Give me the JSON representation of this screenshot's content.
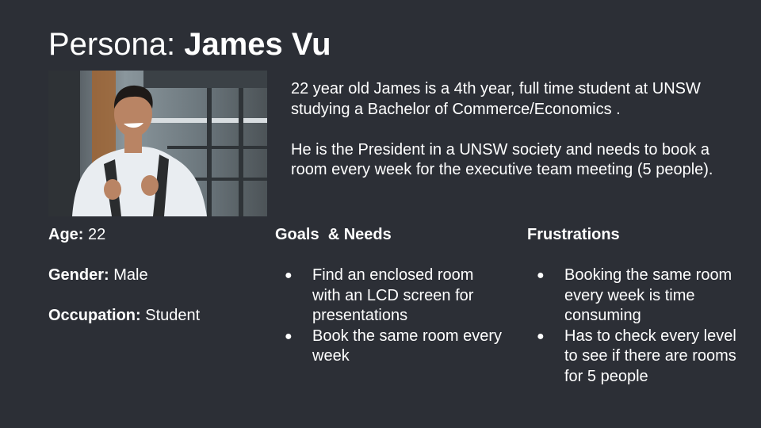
{
  "title": {
    "prefix": "Persona: ",
    "name": "James Vu"
  },
  "bio": {
    "paragraph1": "22 year old James is a 4th year, full time student at UNSW studying a Bachelor of Commerce/Economics .",
    "paragraph2": "He is the President in a UNSW society and needs to book a room every week for the executive team meeting (5 people)."
  },
  "details": {
    "age_label": "Age:",
    "age_value": " 22",
    "gender_label": "Gender:",
    "gender_value": " Male",
    "occupation_label": "Occupation:",
    "occupation_value": " Student"
  },
  "goals": {
    "heading": "Goals  & Needs",
    "bullet": "●",
    "items": [
      "Find an enclosed room with an LCD screen for presentations",
      "Book the same room every week"
    ]
  },
  "frustrations": {
    "heading": "Frustrations",
    "bullet": "●",
    "items": [
      "Booking the same room every week is time consuming",
      "Has to check every level to see if there are rooms for 5 people"
    ]
  },
  "photo": {
    "icon": "persona-photo",
    "bg": "#6e7a80",
    "shirt": "#e9edf1",
    "skin": "#b98464"
  }
}
